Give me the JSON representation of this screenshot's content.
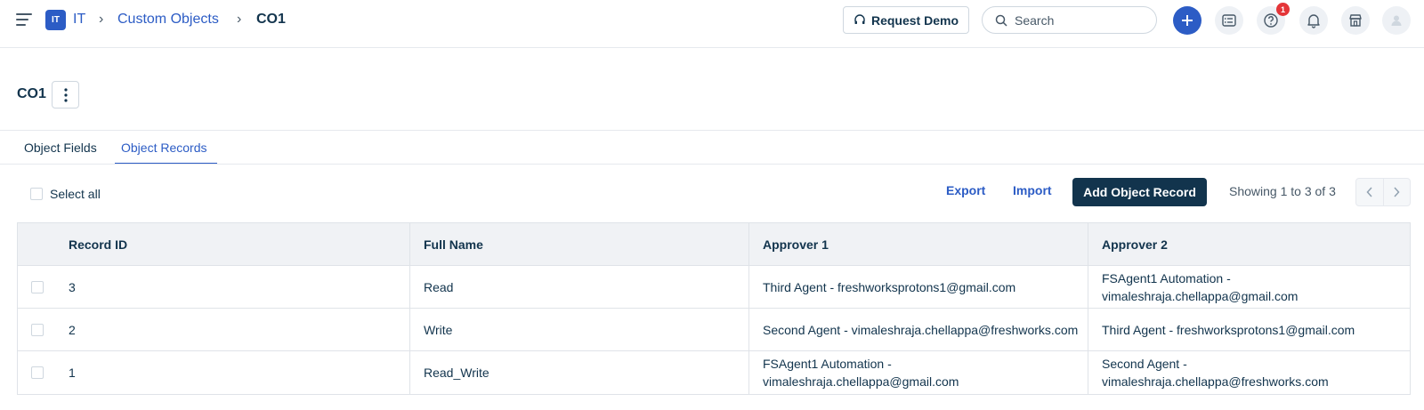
{
  "topbar": {
    "workspace_badge": "IT",
    "breadcrumbs": [
      "IT",
      "Custom Objects",
      "CO1"
    ],
    "request_demo": "Request Demo",
    "search_placeholder": "Search",
    "notification_count": "1"
  },
  "header": {
    "title": "CO1"
  },
  "tabs": [
    {
      "label": "Object Fields",
      "active": false
    },
    {
      "label": "Object Records",
      "active": true
    }
  ],
  "toolbar": {
    "select_all": "Select all",
    "export": "Export",
    "import": "Import",
    "add_record": "Add Object Record",
    "showing": "Showing 1 to 3 of 3"
  },
  "table": {
    "columns": [
      "Record ID",
      "Full Name",
      "Approver 1",
      "Approver 2"
    ],
    "rows": [
      {
        "id": "3",
        "name": "Read",
        "approver1": "Third Agent - freshworksprotons1@gmail.com",
        "approver2": "FSAgent1 Automation - vimaleshraja.chellappa@gmail.com"
      },
      {
        "id": "2",
        "name": "Write",
        "approver1": "Second Agent - vimaleshraja.chellappa@freshworks.com",
        "approver2": "Third Agent - freshworksprotons1@gmail.com"
      },
      {
        "id": "1",
        "name": "Read_Write",
        "approver1": "FSAgent1 Automation - vimaleshraja.chellappa@gmail.com",
        "approver2": "Second Agent - vimaleshraja.chellappa@freshworks.com"
      }
    ]
  },
  "colors": {
    "accent": "#2c5cc5",
    "primary_button": "#12344d",
    "badge_red": "#e43538"
  }
}
